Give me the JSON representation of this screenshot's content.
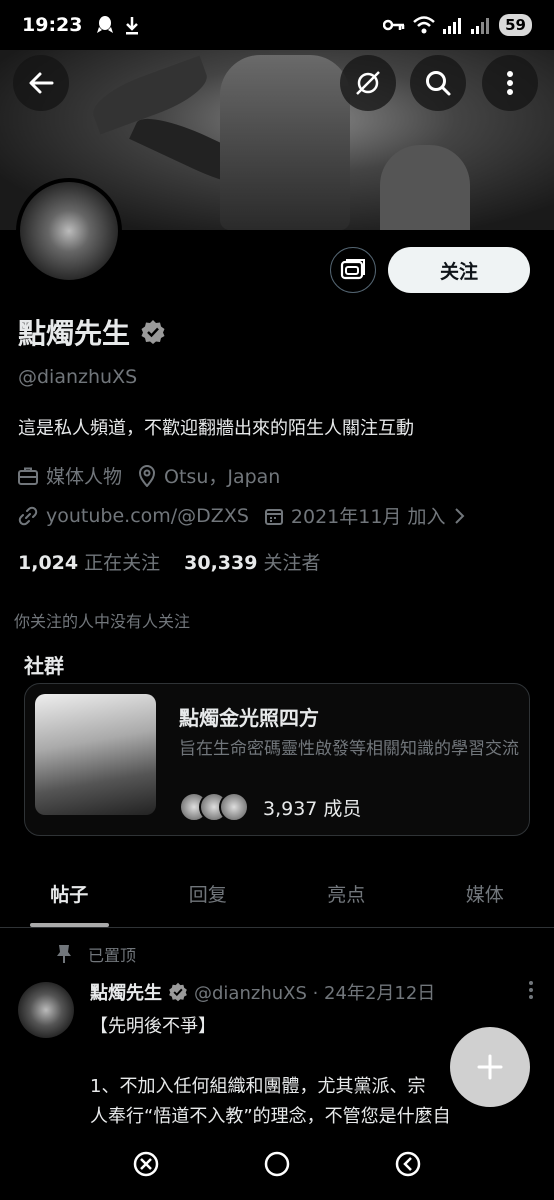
{
  "status_bar": {
    "time": "19:23",
    "battery": "59"
  },
  "profile": {
    "name": "點燭先生",
    "handle": "@dianzhuXS",
    "bio": "這是私人頻道，不歡迎翻牆出來的陌生人關注互動",
    "category": "媒体人物",
    "location": "Otsu，Japan",
    "link": "youtube.com/@DZXS",
    "joined": "2021年11月 加入",
    "following_count": "1,024",
    "following_label": "正在关注",
    "followers_count": "30,339",
    "followers_label": "关注者",
    "mutual_note": "你关注的人中没有人关注",
    "follow_button": "关注"
  },
  "community": {
    "section_title": "社群",
    "name": "點燭金光照四方",
    "description": "旨在生命密碼靈性啟發等相關知識的學習交流",
    "members": "3,937 成员"
  },
  "tabs": [
    {
      "label": "帖子"
    },
    {
      "label": "回复"
    },
    {
      "label": "亮点"
    },
    {
      "label": "媒体"
    }
  ],
  "pinned_post": {
    "pinned_label": "已置顶",
    "author": "點燭先生",
    "handle_date": "@dianzhuXS · 24年2月12日",
    "body": "【先明後不爭】\n\n1、不加入任何組織和團體，尤其黨派、宗\n人奉行“悟道不入教”的理念，不管您是什麼自\n份，別要強給我們用規二作，先拉阿拔我三乎"
  },
  "icons": {
    "back": "back-arrow-icon",
    "grok": "grok-icon",
    "search": "search-icon",
    "more": "more-vertical-icon",
    "message": "message-icon",
    "verified": "verified-badge-icon",
    "briefcase": "briefcase-icon",
    "location": "location-pin-icon",
    "link": "link-icon",
    "calendar": "calendar-icon",
    "pin": "pin-icon",
    "compose": "plus-icon"
  },
  "colors": {
    "background": "#000000",
    "text_primary": "#e7e9ea",
    "text_secondary": "#71767b",
    "follow_button_bg": "#eff3f4"
  }
}
